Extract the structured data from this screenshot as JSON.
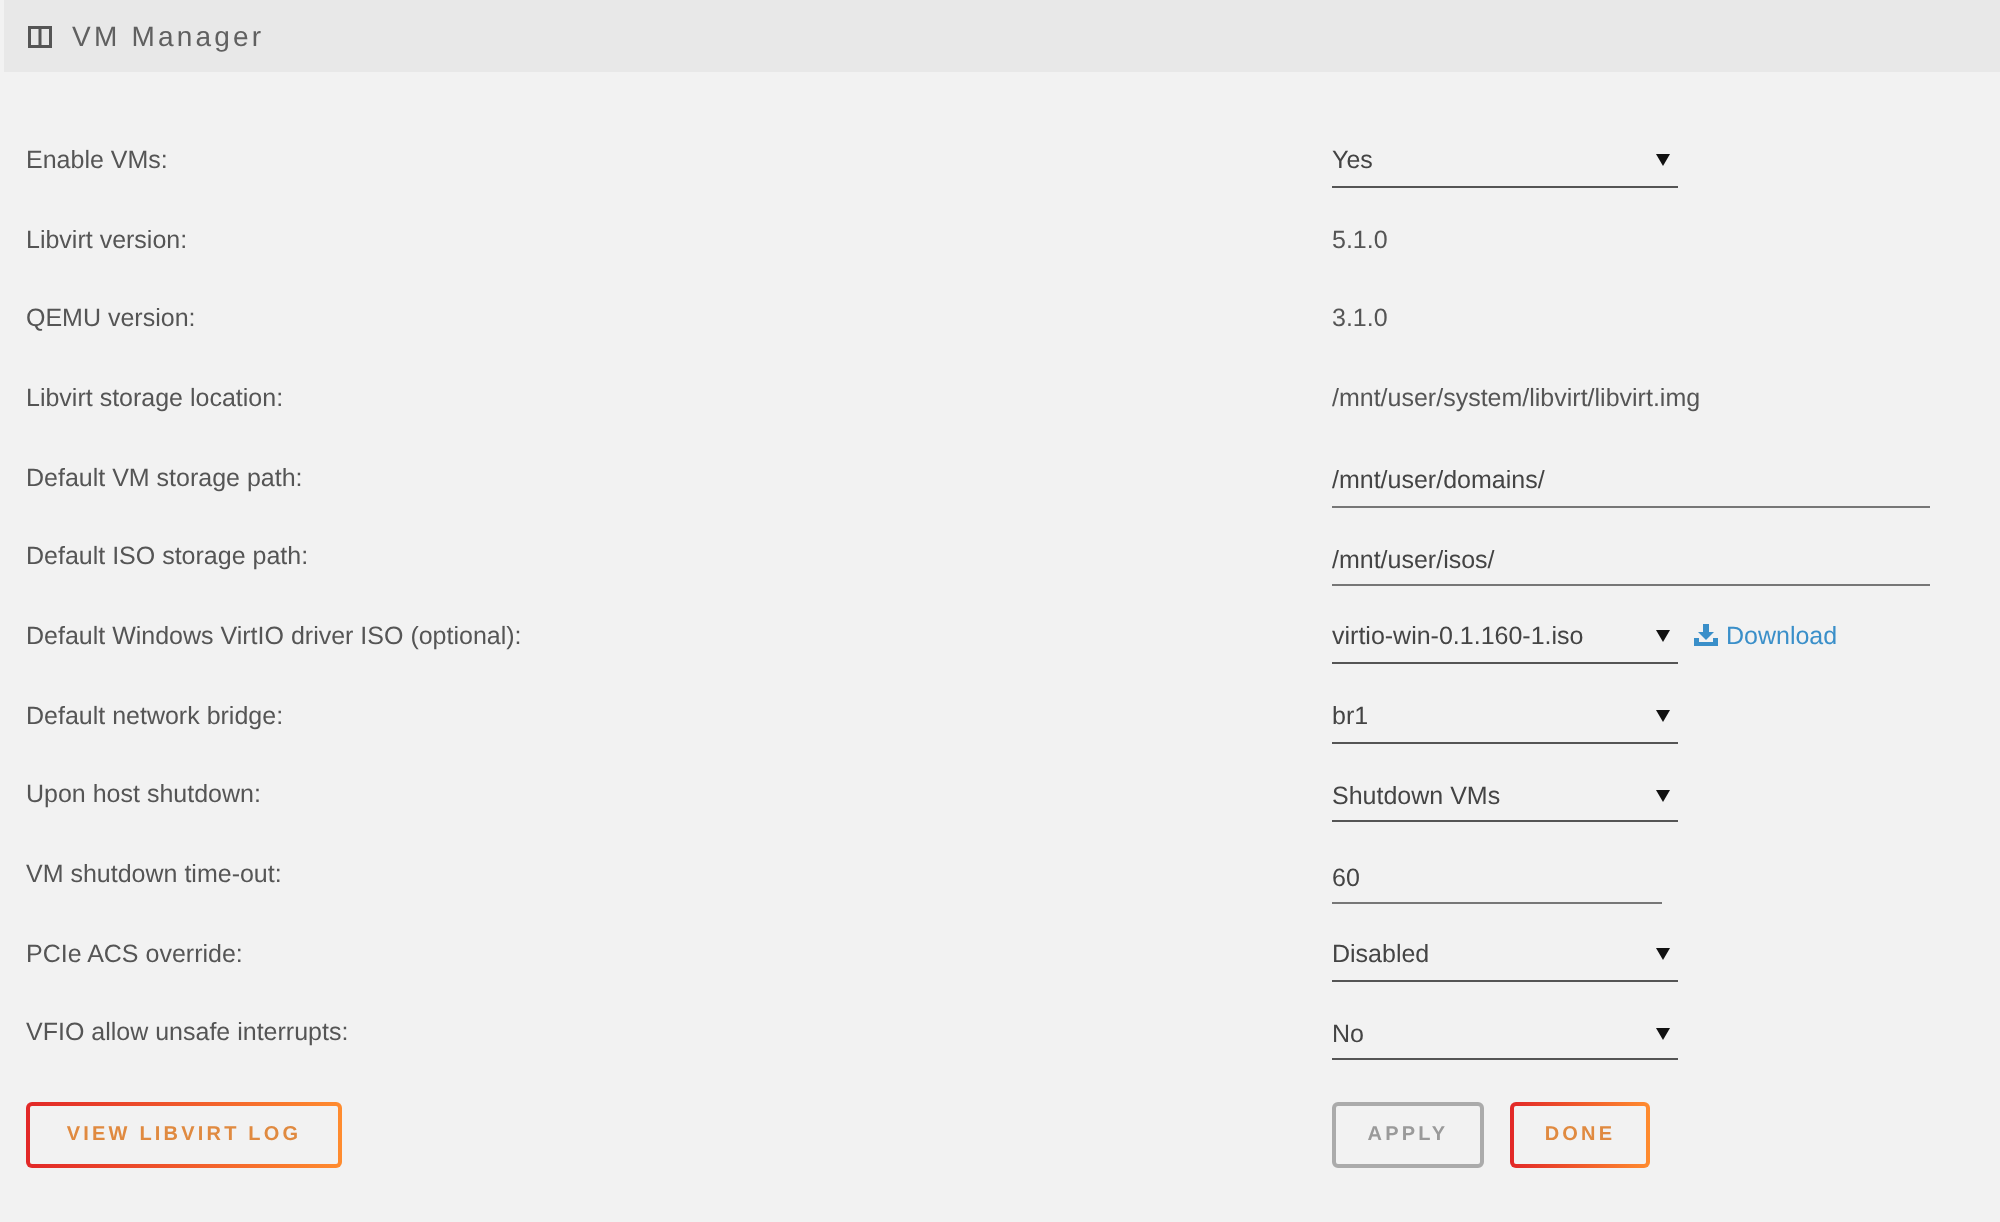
{
  "header": {
    "title": "VM Manager"
  },
  "settings": [
    {
      "label": "Enable VMs:",
      "kind": "select",
      "value": "Yes"
    },
    {
      "label": "Libvirt version:",
      "kind": "text",
      "value": "5.1.0"
    },
    {
      "label": "QEMU version:",
      "kind": "text",
      "value": "3.1.0"
    },
    {
      "label": "Libvirt storage location:",
      "kind": "text",
      "value": "/mnt/user/system/libvirt/libvirt.img"
    },
    {
      "label": "Default VM storage path:",
      "kind": "path_input",
      "value": "/mnt/user/domains/"
    },
    {
      "label": "Default ISO storage path:",
      "kind": "path_input",
      "value": "/mnt/user/isos/"
    },
    {
      "label": "Default Windows VirtIO driver ISO (optional):",
      "kind": "select",
      "value": "virtio-win-0.1.160-1.iso",
      "link": "Download"
    },
    {
      "label": "Default network bridge:",
      "kind": "select",
      "value": "br1"
    },
    {
      "label": "Upon host shutdown:",
      "kind": "select",
      "value": "Shutdown VMs"
    },
    {
      "label": "VM shutdown time-out:",
      "kind": "number_input",
      "value": "60"
    },
    {
      "label": "PCIe ACS override:",
      "kind": "select",
      "value": "Disabled"
    },
    {
      "label": "VFIO allow unsafe interrupts:",
      "kind": "select",
      "value": "No"
    }
  ],
  "footer": {
    "log_button": {
      "label": "VIEW LIBVIRT LOG",
      "disabled": false
    },
    "buttons": [
      {
        "label": "APPLY",
        "disabled": true
      },
      {
        "label": "DONE",
        "disabled": false
      }
    ]
  }
}
